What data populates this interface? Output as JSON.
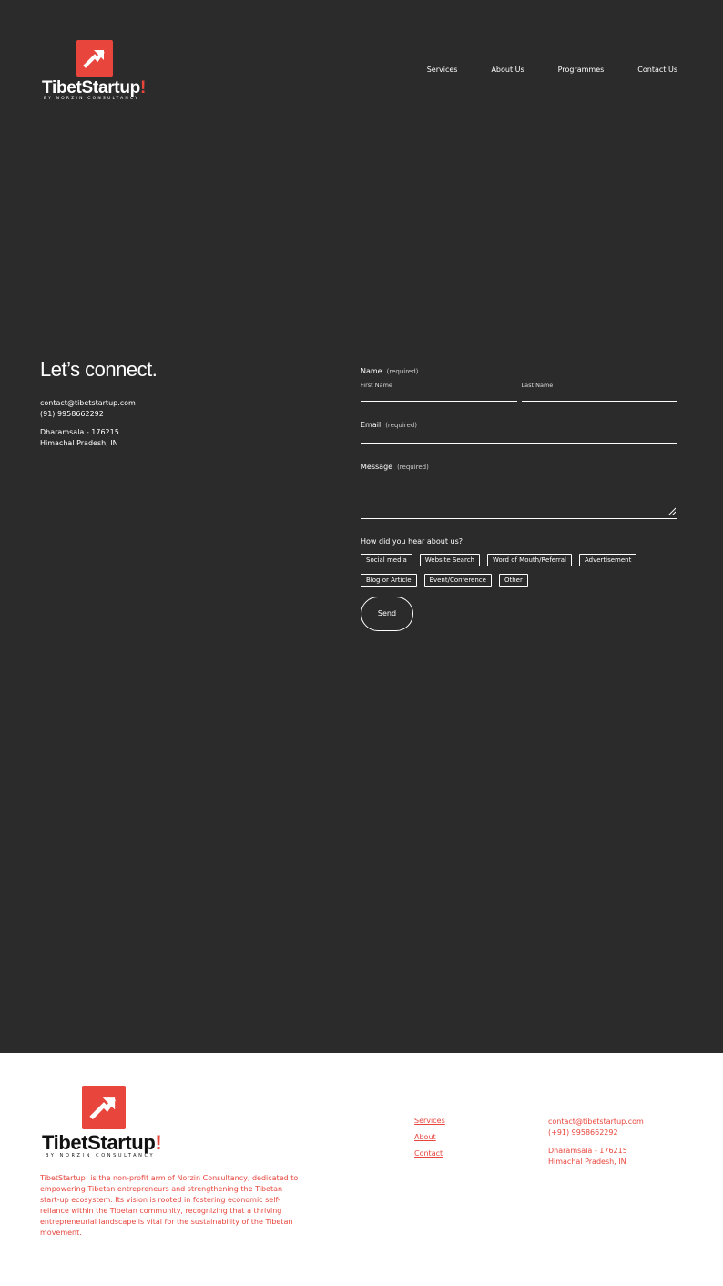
{
  "brand": {
    "name": "TibetStartup",
    "bang": "!",
    "tagline": "BY NORZIN CONSULTANCY",
    "accent": "#e8453c",
    "icon": "arrow-up-right-icon"
  },
  "nav": {
    "items": [
      {
        "label": "Services"
      },
      {
        "label": "About Us"
      },
      {
        "label": "Programmes"
      },
      {
        "label": "Contact Us",
        "active": true
      }
    ]
  },
  "contact": {
    "heading": "Let’s connect.",
    "email": "contact@tibetstartup.com",
    "phone": "(91) 9958662292",
    "address_line1": "Dharamsala - 176215",
    "address_line2": "Himachal Pradesh, IN"
  },
  "form": {
    "name_label": "Name",
    "required": "(required)",
    "first_name_label": "First Name",
    "last_name_label": "Last Name",
    "email_label": "Email",
    "message_label": "Message",
    "hear_label": "How did you hear about us?",
    "options": [
      "Social media",
      "Website Search",
      "Word of Mouth/Referral",
      "Advertisement",
      "Blog or Article",
      "Event/Conference",
      "Other"
    ],
    "send_label": "Send"
  },
  "footer": {
    "description": "TibetStartup! is the non-profit arm of Norzin Consultancy, dedicated to empowering Tibetan entrepreneurs and strengthening the Tibetan start-up ecosystem. Its vision is rooted in fostering economic self-reliance within the Tibetan community, recognizing that a thriving entrepreneurial landscape is vital for the sustainability of the Tibetan movement.",
    "links": [
      "Services",
      "About",
      "Contact"
    ],
    "email": "contact@tibetstartup.com",
    "phone": "(+91) 9958662292",
    "address_line1": "Dharamsala - 176215",
    "address_line2": "Himachal Pradesh, IN"
  }
}
